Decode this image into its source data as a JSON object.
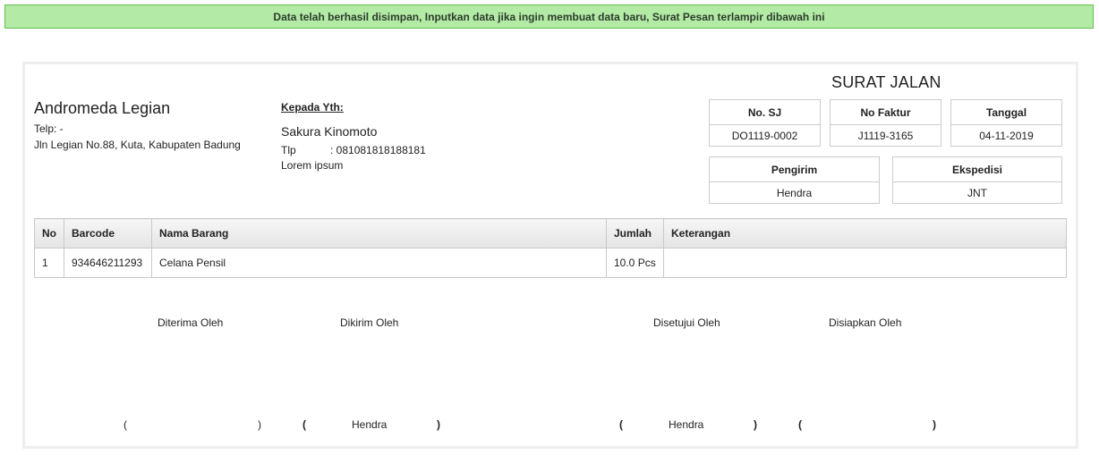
{
  "alert": {
    "message": "Data telah berhasil disimpan, Inputkan data jika ingin membuat data baru, Surat Pesan terlampir dibawah ini"
  },
  "doc_title": "SURAT JALAN",
  "company": {
    "name": "Andromeda Legian",
    "phone": "Telp: -",
    "address": "Jln Legian No.88, Kuta, Kabupaten Badung"
  },
  "recipient": {
    "label": "Kepada Yth:",
    "name": "Sakura Kinomoto",
    "phone_label": "Tlp",
    "phone_value": ": 081081818188181",
    "address": "Lorem ipsum"
  },
  "info": {
    "no_sj": {
      "label": "No. SJ",
      "value": "DO1119-0002"
    },
    "no_faktur": {
      "label": "No Faktur",
      "value": "J1119-3165"
    },
    "tanggal": {
      "label": "Tanggal",
      "value": "04-11-2019"
    },
    "pengirim": {
      "label": "Pengirim",
      "value": "Hendra"
    },
    "ekspedisi": {
      "label": "Ekspedisi",
      "value": "JNT"
    }
  },
  "table": {
    "headers": [
      "No",
      "Barcode",
      "Nama Barang",
      "Jumlah",
      "Keterangan"
    ],
    "rows": [
      [
        "1",
        "934646211293",
        "Celana Pensil",
        "10.0 Pcs",
        ""
      ]
    ]
  },
  "signatures": {
    "diterima": {
      "label": "Diterima Oleh",
      "name": ""
    },
    "dikirim": {
      "label": "Dikirim Oleh",
      "name": "Hendra"
    },
    "disetujui": {
      "label": "Disetujui Oleh",
      "name": "Hendra"
    },
    "disiapkan": {
      "label": "Disiapkan Oleh",
      "name": ""
    },
    "open_paren": "(",
    "close_paren": ")"
  }
}
